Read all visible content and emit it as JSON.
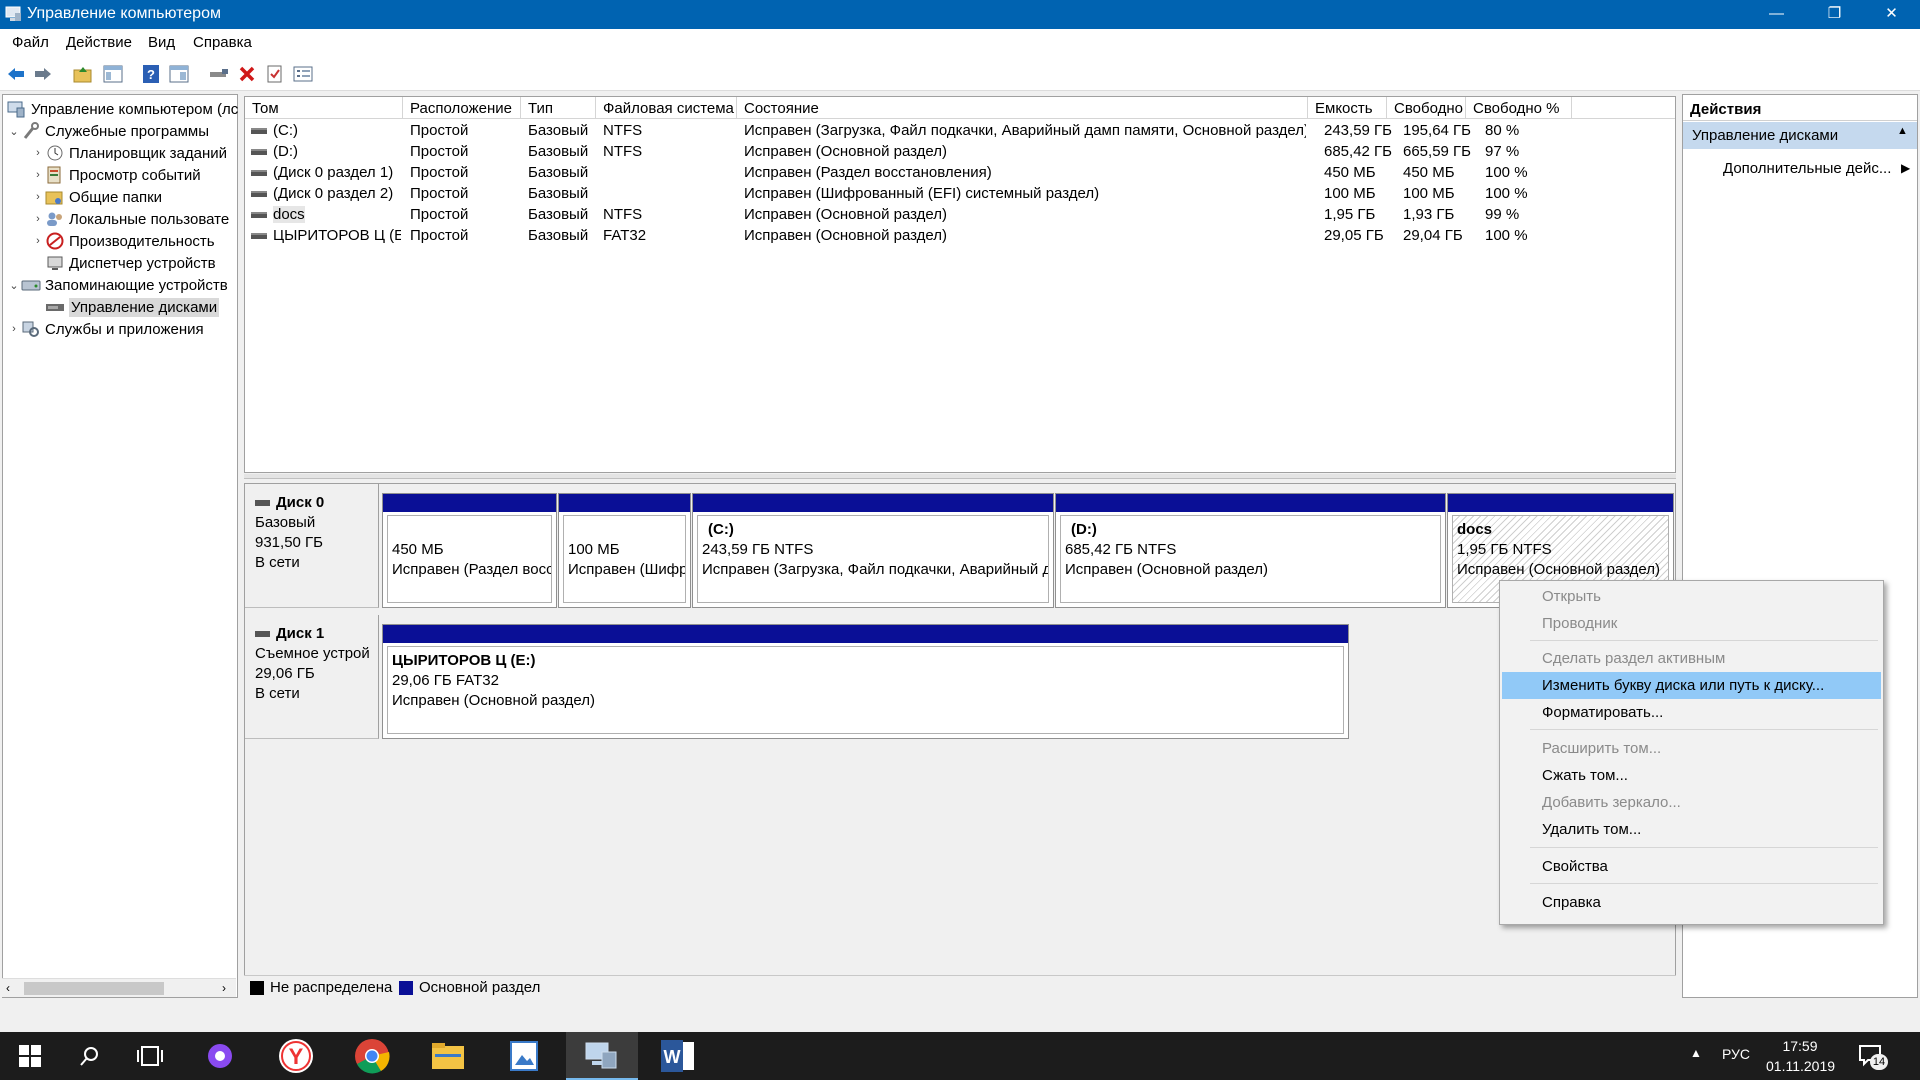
{
  "window": {
    "title": "Управление компьютером",
    "minimize": "—",
    "maximize": "❐",
    "close": "✕"
  },
  "menu": [
    "Файл",
    "Действие",
    "Вид",
    "Справка"
  ],
  "tree": {
    "root": "Управление компьютером (лс",
    "utilities": "Служебные программы",
    "scheduler": "Планировщик заданий",
    "events": "Просмотр событий",
    "shared": "Общие папки",
    "local_users": "Локальные пользовате",
    "performance": "Производительность",
    "device_manager": "Диспетчер устройств",
    "storage": "Запоминающие устройств",
    "disk_mgmt": "Управление дисками",
    "services": "Службы и приложения"
  },
  "volume_list": {
    "headers": [
      "Том",
      "Расположение",
      "Тип",
      "Файловая система",
      "Состояние",
      "Емкость",
      "Свободно",
      "Свободно %"
    ],
    "rows": [
      [
        "(C:)",
        "Простой",
        "Базовый",
        "NTFS",
        "Исправен (Загрузка, Файл подкачки, Аварийный дамп памяти, Основной раздел)",
        "243,59 ГБ",
        "195,64 ГБ",
        "80 %"
      ],
      [
        "(D:)",
        "Простой",
        "Базовый",
        "NTFS",
        "Исправен (Основной раздел)",
        "685,42 ГБ",
        "665,59 ГБ",
        "97 %"
      ],
      [
        "(Диск 0 раздел 1)",
        "Простой",
        "Базовый",
        "",
        "Исправен (Раздел восстановления)",
        "450 МБ",
        "450 МБ",
        "100 %"
      ],
      [
        "(Диск 0 раздел 2)",
        "Простой",
        "Базовый",
        "",
        "Исправен (Шифрованный (EFI) системный раздел)",
        "100 МБ",
        "100 МБ",
        "100 %"
      ],
      [
        "docs",
        "Простой",
        "Базовый",
        "NTFS",
        "Исправен (Основной раздел)",
        "1,95 ГБ",
        "1,93 ГБ",
        "99 %"
      ],
      [
        "ЦЫРИТОРОВ Ц (E:)",
        "Простой",
        "Базовый",
        "FAT32",
        "Исправен (Основной раздел)",
        "29,05 ГБ",
        "29,04 ГБ",
        "100 %"
      ]
    ]
  },
  "disk0": {
    "name": "Диск 0",
    "type": "Базовый",
    "size": "931,50 ГБ",
    "status": "В сети",
    "parts": [
      {
        "title": "",
        "size": "450 МБ",
        "status": "Исправен (Раздел восс"
      },
      {
        "title": "",
        "size": "100 МБ",
        "status": "Исправен (Шифр"
      },
      {
        "title": "(C:)",
        "size": "243,59 ГБ NTFS",
        "status": "Исправен (Загрузка, Файл подкачки, Аварийный д"
      },
      {
        "title": "(D:)",
        "size": "685,42 ГБ NTFS",
        "status": "Исправен (Основной раздел)"
      },
      {
        "title": "docs",
        "size": "1,95 ГБ NTFS",
        "status": "Исправен (Основной раздел)"
      }
    ]
  },
  "disk1": {
    "name": "Диск 1",
    "type": "Съемное устрой",
    "size": "29,06 ГБ",
    "status": "В сети",
    "part": {
      "title": "ЦЫРИТОРОВ Ц  (E:)",
      "size": "29,06 ГБ FAT32",
      "status": "Исправен (Основной раздел)"
    }
  },
  "legend": {
    "unallocated": "Не распределена",
    "primary": "Основной раздел",
    "unallocated_color": "#000000",
    "primary_color": "#0a0f96"
  },
  "actions": {
    "header": "Действия",
    "section": "Управление дисками",
    "more": "Дополнительные дейс..."
  },
  "context_menu": {
    "open": "Открыть",
    "explorer": "Проводник",
    "make_active": "Сделать раздел активным",
    "change_letter": "Изменить букву диска или путь к диску...",
    "format": "Форматировать...",
    "extend": "Расширить том...",
    "shrink": "Сжать том...",
    "mirror": "Добавить зеркало...",
    "delete": "Удалить том...",
    "properties": "Свойства",
    "help": "Справка"
  },
  "taskbar": {
    "language": "РУС",
    "time": "17:59",
    "date": "01.11.2019",
    "notifications": "14"
  }
}
